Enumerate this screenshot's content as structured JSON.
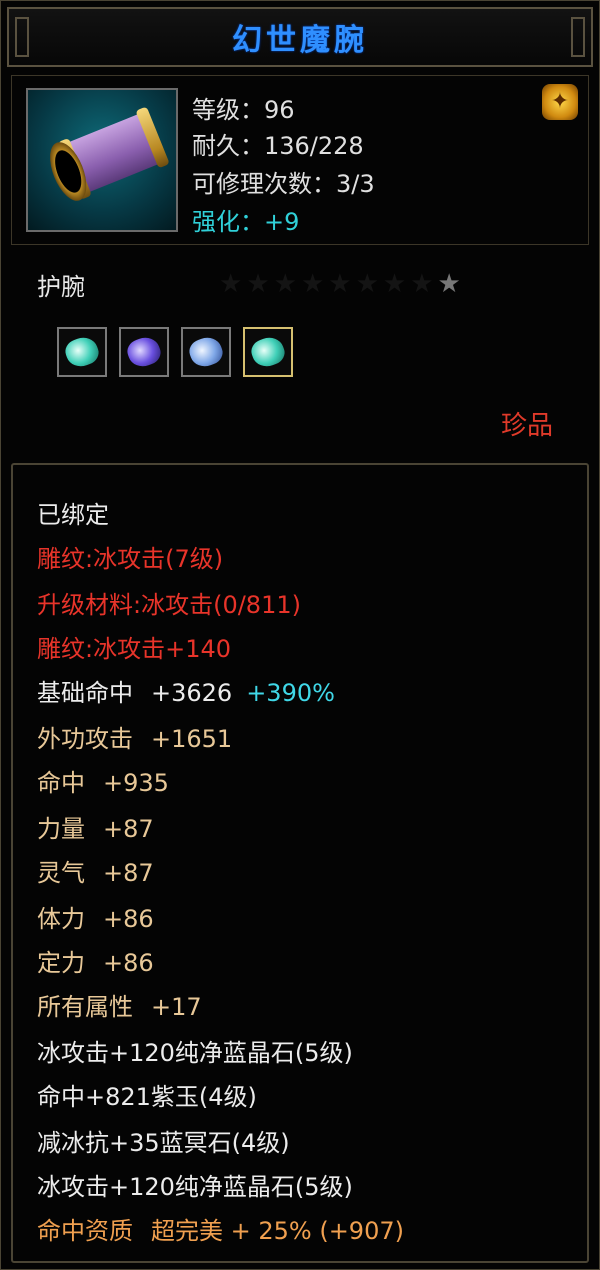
{
  "title": "幻世魔腕",
  "header": {
    "level": "等级：96",
    "durability": "耐久：136/228",
    "repair": "可修理次数：3/3",
    "enhance": "强化：+9",
    "dragon_icon": "gold-dragon-icon"
  },
  "item": {
    "type": "护腕",
    "stars_total": 9,
    "rarity": "珍品",
    "gems": [
      "cyan-gem",
      "purple-gem",
      "blue-gem",
      "cyan-gem"
    ]
  },
  "attrs": {
    "bound": "已绑定",
    "engrave": "雕纹:冰攻击(7级)",
    "upgrade": "升级材料:冰攻击(0/811)",
    "engrave_bonus": "雕纹:冰攻击+140",
    "base_hit_label": "基础命中",
    "base_hit_value": "+3626",
    "base_hit_pct": "+390%",
    "ext_atk_label": "外功攻击",
    "ext_atk_value": "+1651",
    "hit_label": "命中",
    "hit_value": "+935",
    "str_label": "力量",
    "str_value": "+87",
    "spirit_label": "灵气",
    "spirit_value": "+87",
    "vit_label": "体力",
    "vit_value": "+86",
    "focus_label": "定力",
    "focus_value": "+86",
    "all_label": "所有属性",
    "all_value": "+17",
    "gem1": "冰攻击+120纯净蓝晶石(5级)",
    "gem2": "命中+821紫玉(4级)",
    "gem3": "减冰抗+35蓝冥石(4级)",
    "gem4": "冰攻击+120纯净蓝晶石(5级)",
    "quality_label": "命中资质",
    "quality_value": "超完美 + 25% (+907)"
  }
}
